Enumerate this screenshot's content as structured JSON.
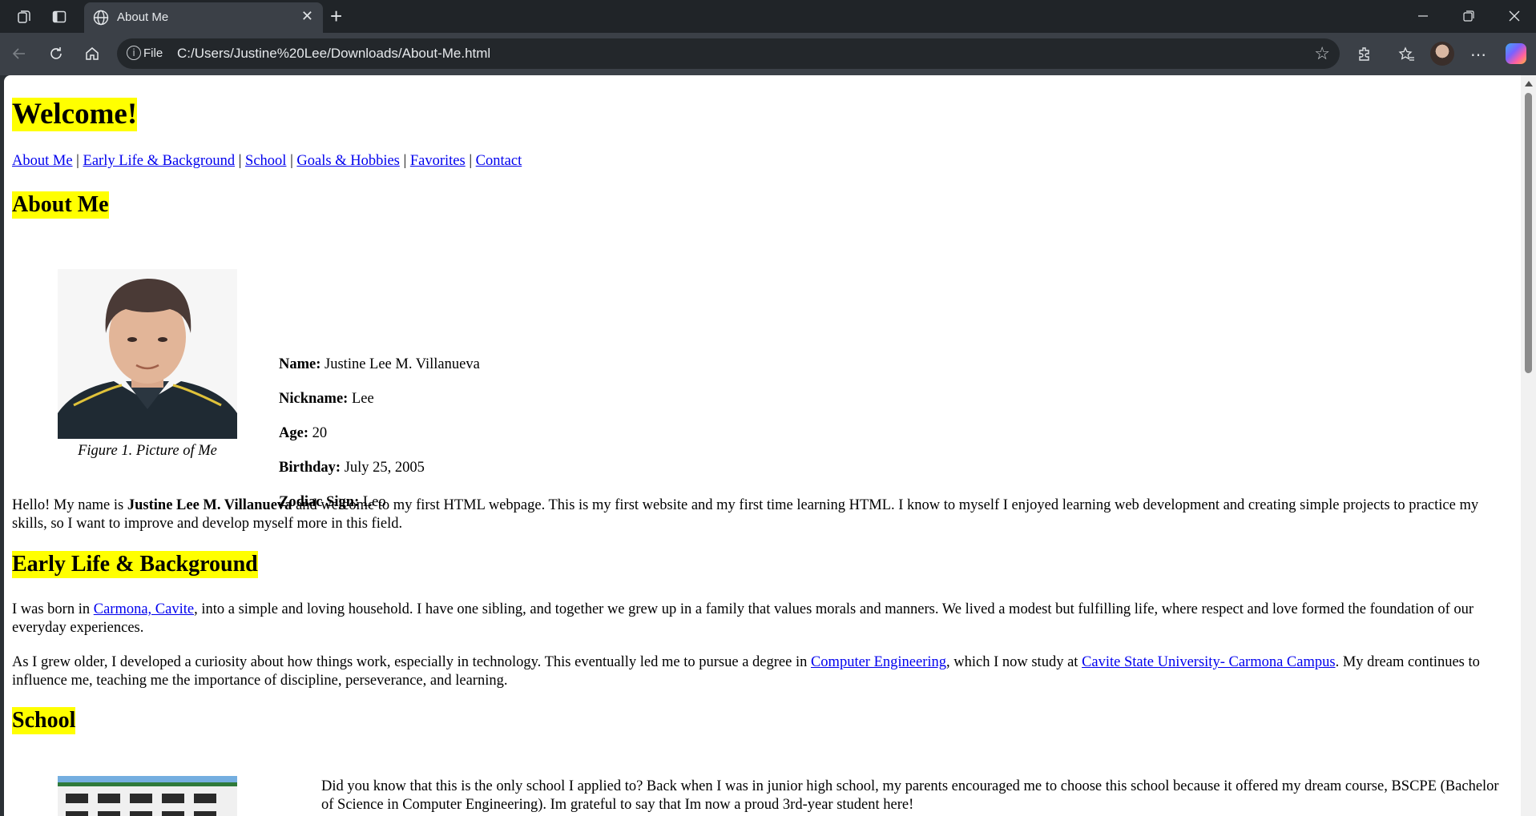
{
  "browser": {
    "tab_title": "About Me",
    "url_scheme_label": "File",
    "url": "C:/Users/Justine%20Lee/Downloads/About-Me.html",
    "icons": [
      "workspaces-icon",
      "vertical-tabs-icon",
      "globe-icon",
      "close-icon",
      "plus-icon",
      "minimize-icon",
      "restore-icon",
      "window-close-icon",
      "back-icon",
      "refresh-icon",
      "home-icon",
      "info-icon",
      "star-icon",
      "extensions-icon",
      "favorites-icon",
      "profile-avatar",
      "more-icon",
      "copilot-icon"
    ]
  },
  "page": {
    "title": "Welcome!",
    "nav": [
      "About Me",
      "Early Life & Background",
      "School",
      "Goals & Hobbies",
      "Favorites",
      "Contact"
    ],
    "nav_separator": "|",
    "about": {
      "heading": "About Me",
      "figure_caption": "Figure 1. Picture of Me",
      "info": [
        {
          "label": "Name:",
          "value": "Justine Lee M. Villanueva"
        },
        {
          "label": "Nickname:",
          "value": "Lee"
        },
        {
          "label": "Age:",
          "value": "20"
        },
        {
          "label": "Birthday:",
          "value": "July 25, 2005"
        },
        {
          "label": "Zodiac Sign:",
          "value": "Leo"
        }
      ],
      "intro_pre": "Hello! My name is ",
      "intro_name": "Justine Lee M. Villanueva",
      "intro_post": " and welcome to my first HTML webpage. This is my first website and my first time learning HTML. I know to myself I enjoyed learning web development and creating simple projects to practice my skills, so I want to improve and develop myself more in this field."
    },
    "early_life": {
      "heading": "Early Life & Background",
      "p1_pre": "I was born in ",
      "p1_link": "Carmona, Cavite",
      "p1_post": ", into a simple and loving household. I have one sibling, and together we grew up in a family that values morals and manners. We lived a modest but fulfilling life, where respect and love formed the foundation of our everyday experiences.",
      "p2_pre": "As I grew older, I developed a curiosity about how things work, especially in technology. This eventually led me to pursue a degree in ",
      "p2_link1": "Computer Engineering",
      "p2_mid": ", which I now study at ",
      "p2_link2": "Cavite State University- Carmona Campus",
      "p2_post": ". My dream continues to influence me, teaching me the importance of discipline, perseverance, and learning."
    },
    "school": {
      "heading": "School",
      "text": "Did you know that this is the only school I applied to? Back when I was in junior high school, my parents encouraged me to choose this school because it offered my dream course, BSCPE (Bachelor of Science in Computer Engineering). Im grateful to say that Im now a proud 3rd-year student here!"
    }
  },
  "colors": {
    "highlight": "#ffff00",
    "link": "#0000ee",
    "chrome_dark": "#202428",
    "chrome_toolbar": "#3b4047"
  }
}
